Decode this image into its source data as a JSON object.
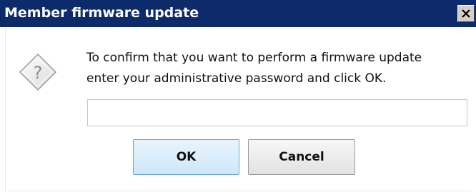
{
  "window": {
    "title": "Member firmware update",
    "close_icon": "close-icon"
  },
  "message": {
    "icon": "question-icon",
    "line1": "To confirm that you want to perform a firmware update",
    "line2": "enter your administrative password and click OK."
  },
  "password": {
    "value": "",
    "placeholder": ""
  },
  "buttons": {
    "ok_label": "OK",
    "cancel_label": "Cancel"
  },
  "colors": {
    "titlebar": "#0d2a6b",
    "ok_border": "#6ba6d6",
    "ok_fill": "#cfe7fa"
  }
}
